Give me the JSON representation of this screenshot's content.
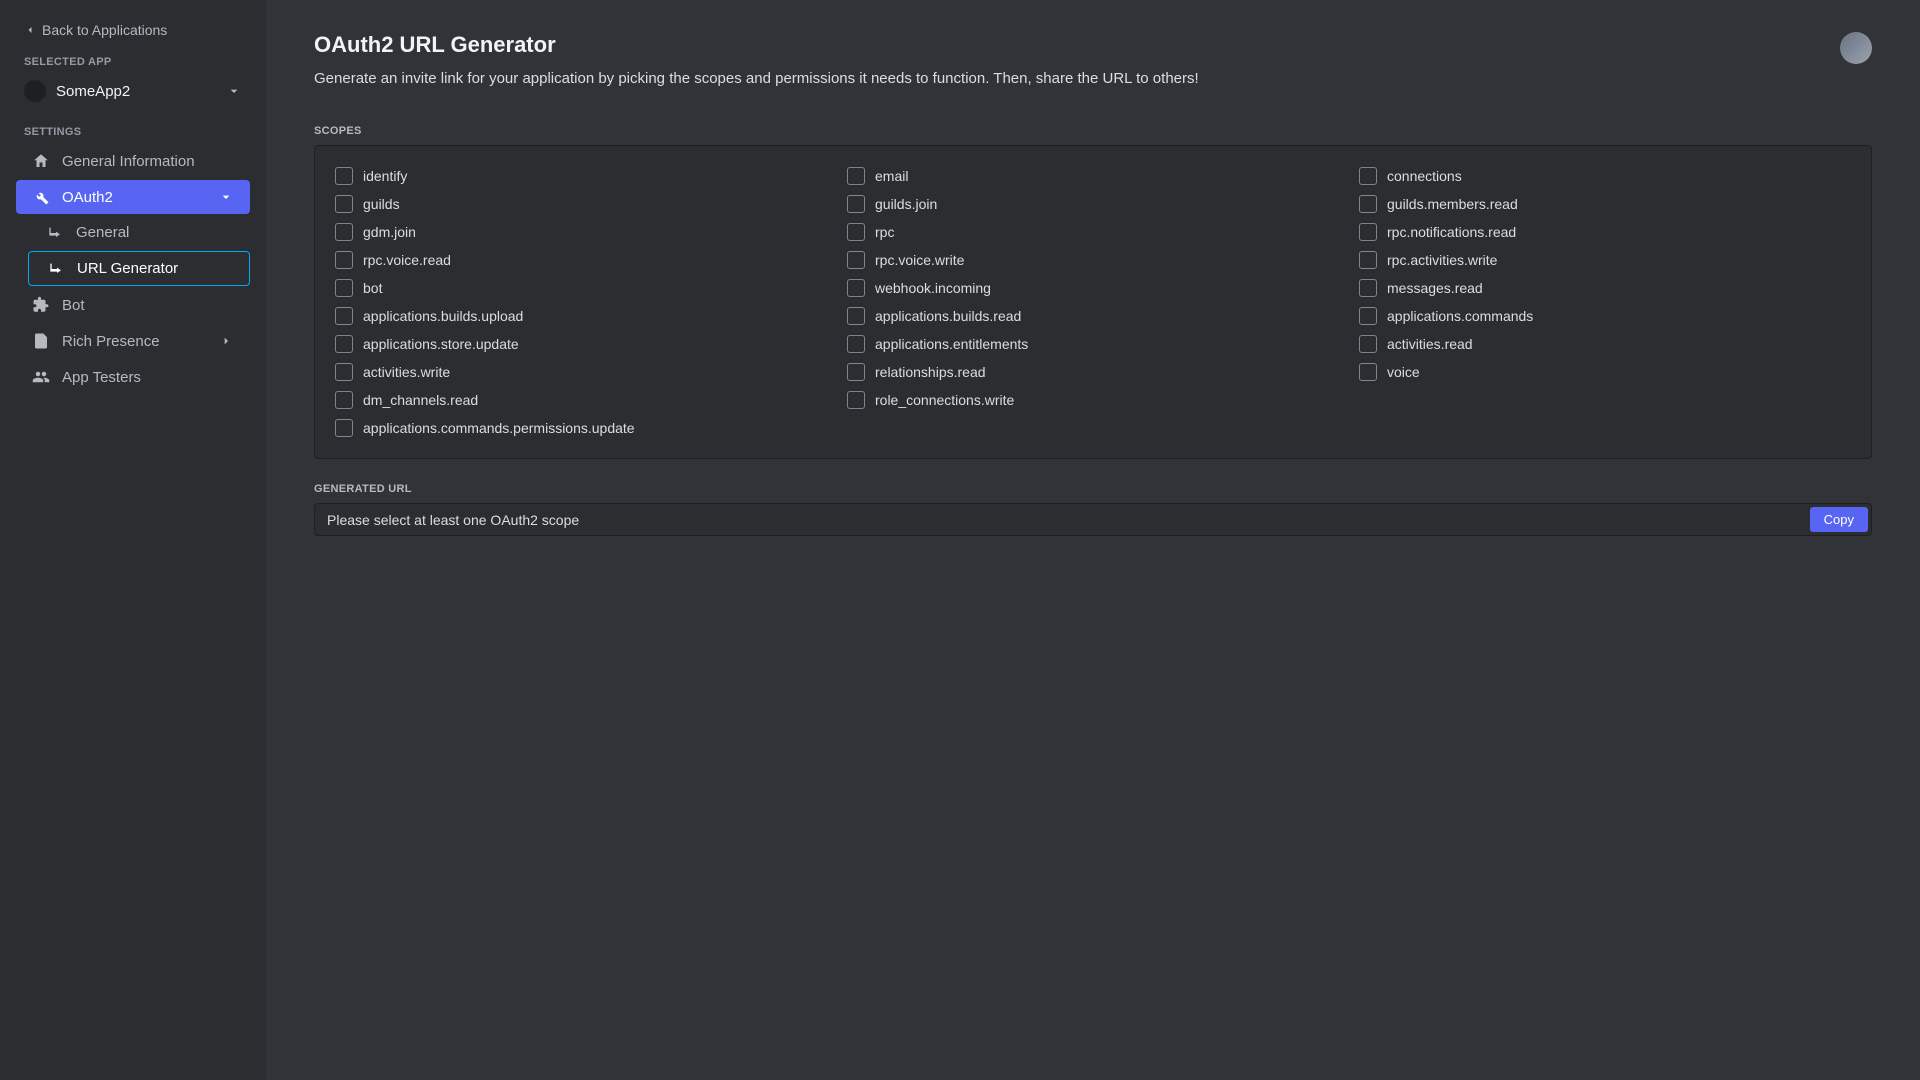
{
  "sidebar": {
    "back_label": "Back to Applications",
    "selected_app_label": "SELECTED APP",
    "app_name": "SomeApp2",
    "settings_label": "SETTINGS",
    "nav": {
      "general_info": "General Information",
      "oauth2": "OAuth2",
      "oauth2_general": "General",
      "oauth2_url_gen": "URL Generator",
      "bot": "Bot",
      "rich_presence": "Rich Presence",
      "app_testers": "App Testers"
    }
  },
  "main": {
    "title": "OAuth2 URL Generator",
    "subtitle": "Generate an invite link for your application by picking the scopes and permissions it needs to function. Then, share the URL to others!",
    "scopes_label": "SCOPES",
    "generated_url_label": "GENERATED URL",
    "url_placeholder": "Please select at least one OAuth2 scope",
    "copy_label": "Copy"
  },
  "scopes": {
    "col1": [
      "identify",
      "guilds",
      "gdm.join",
      "rpc.voice.read",
      "bot",
      "applications.builds.upload",
      "applications.store.update",
      "activities.write",
      "dm_channels.read",
      "applications.commands.permissions.update"
    ],
    "col2": [
      "email",
      "guilds.join",
      "rpc",
      "rpc.voice.write",
      "webhook.incoming",
      "applications.builds.read",
      "applications.entitlements",
      "relationships.read",
      "role_connections.write"
    ],
    "col3": [
      "connections",
      "guilds.members.read",
      "rpc.notifications.read",
      "rpc.activities.write",
      "messages.read",
      "applications.commands",
      "activities.read",
      "voice"
    ]
  }
}
